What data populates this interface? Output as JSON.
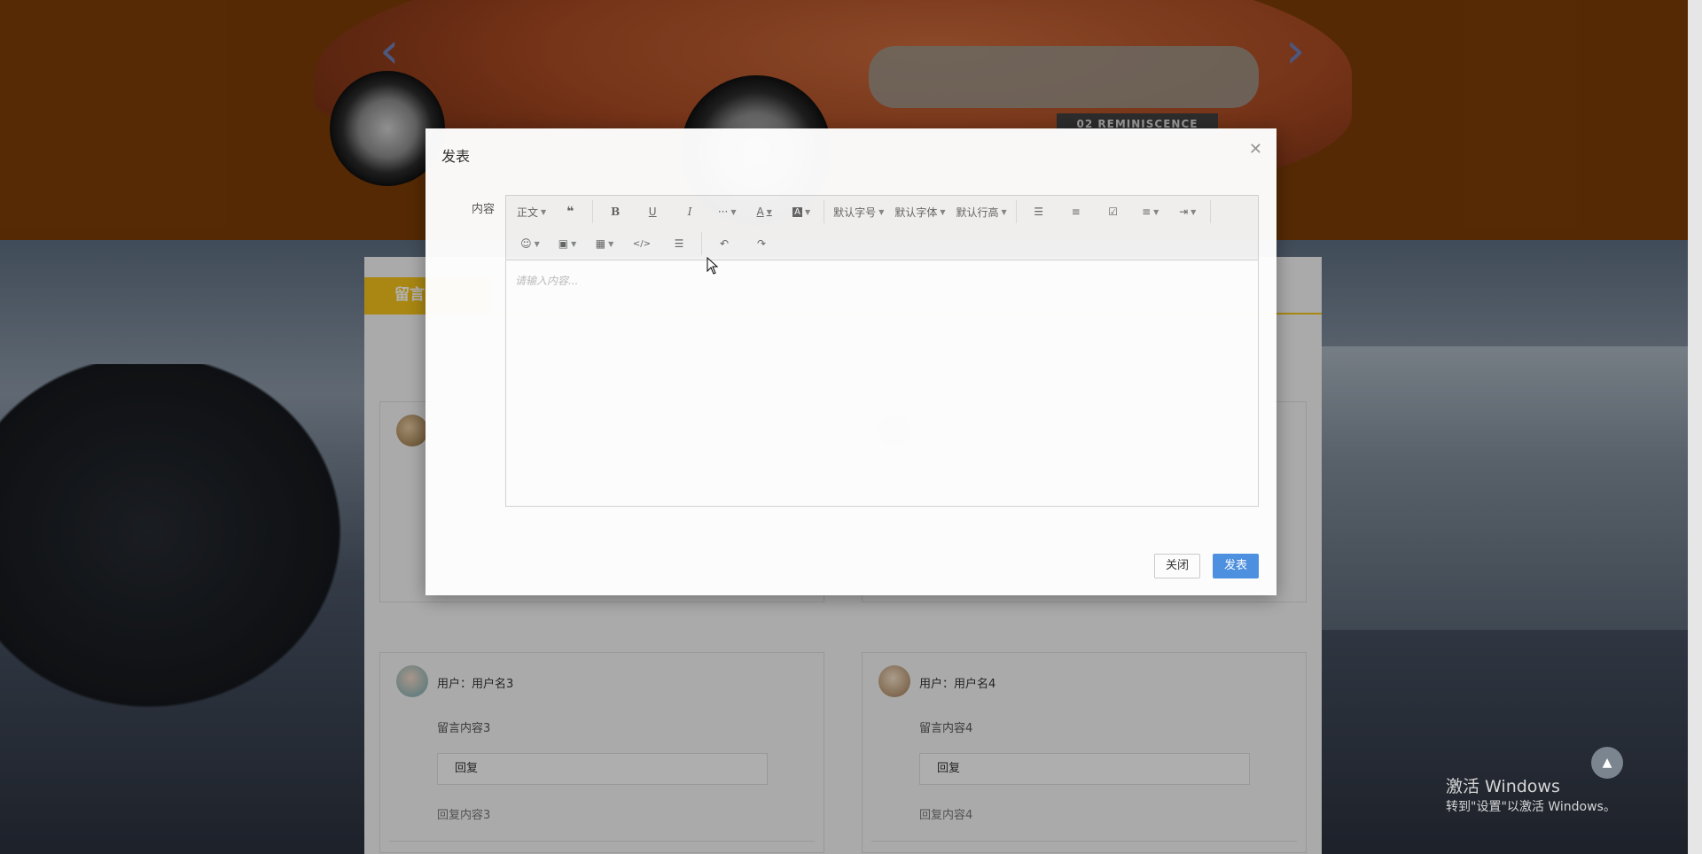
{
  "hero": {
    "plate_text": "02 REMINISCENCE",
    "prev_arrow_icon": "chevron-left-icon",
    "next_arrow_icon": "chevron-right-icon"
  },
  "panel": {
    "tab_label": "留言",
    "cards": [
      {
        "user": "用户：用户名3",
        "content": "留言内容3",
        "reply_label": "回复",
        "reply_content": "回复内容3"
      },
      {
        "user": "用户：用户名4",
        "content": "留言内容4",
        "reply_label": "回复",
        "reply_content": "回复内容4"
      }
    ]
  },
  "modal": {
    "title": "发表",
    "close_icon": "close-icon",
    "field_label": "内容",
    "toolbar": {
      "paragraph": "正文",
      "font_size": "默认字号",
      "font_family": "默认字体",
      "line_height": "默认行高",
      "more": "···"
    },
    "placeholder": "请输入内容...",
    "close_button": "关闭",
    "publish_button": "发表"
  },
  "watermark": {
    "line1": "激活 Windows",
    "line2": "转到\"设置\"以激活 Windows。"
  },
  "colors": {
    "accent_yellow": "#f3c21b",
    "primary_blue": "#4a90e2",
    "hero_bg": "#7a3c06"
  }
}
